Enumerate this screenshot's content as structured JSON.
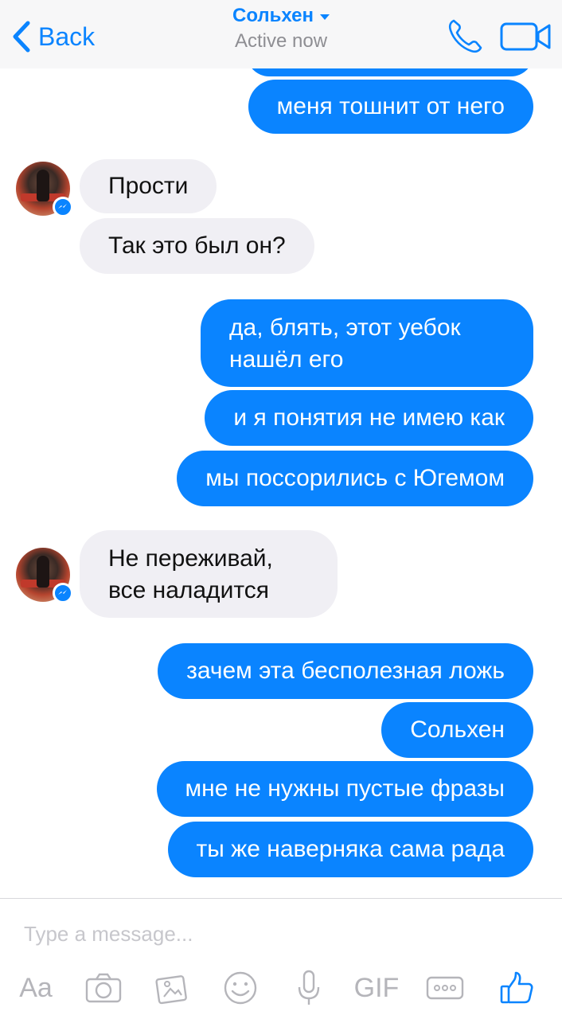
{
  "header": {
    "back_label": "Back",
    "contact_name": "Сольхен",
    "status": "Active now"
  },
  "messages": [
    {
      "side": "out",
      "text": "меня тошнит от него"
    },
    {
      "side": "in",
      "text": "Прости"
    },
    {
      "side": "in",
      "text": "Так это был он?"
    },
    {
      "side": "out",
      "text": "да, блять, этот уебок нашёл его"
    },
    {
      "side": "out",
      "text": "и я понятия не имею как"
    },
    {
      "side": "out",
      "text": "мы поссорились с Югемом"
    },
    {
      "side": "in",
      "text": "Не переживай, все наладится"
    },
    {
      "side": "out",
      "text": "зачем эта бесполезная ложь"
    },
    {
      "side": "out",
      "text": "Сольхен"
    },
    {
      "side": "out",
      "text": "мне не нужны пустые фразы"
    },
    {
      "side": "out",
      "text": "ты же наверняка сама рада"
    }
  ],
  "composer": {
    "placeholder": "Type a message...",
    "text_tool_label": "Aa",
    "gif_label": "GIF"
  },
  "colors": {
    "accent": "#0a84ff",
    "incoming_bubble": "#f0eff4",
    "icon_gray": "#b5b5ba"
  },
  "icons": [
    "chevron-left-icon",
    "caret-down-icon",
    "phone-icon",
    "video-camera-icon",
    "messenger-badge-icon",
    "camera-icon",
    "photo-icon",
    "emoji-icon",
    "microphone-icon",
    "more-icon",
    "thumbs-up-icon"
  ]
}
